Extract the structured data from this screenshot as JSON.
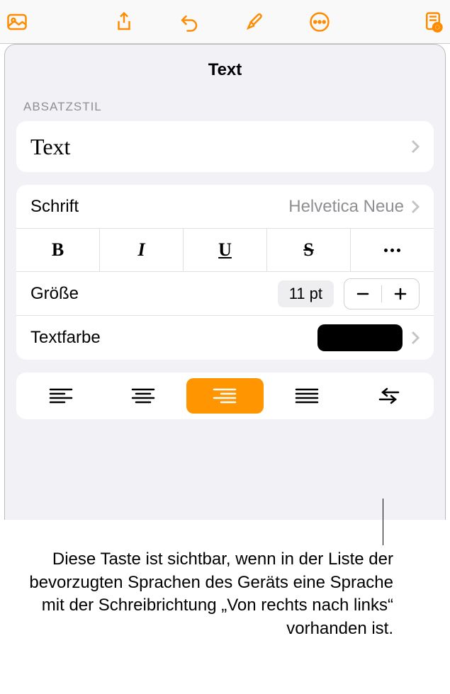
{
  "panel": {
    "title": "Text",
    "section_label": "ABSATZSTIL",
    "style_name": "Text",
    "font_label": "Schrift",
    "font_value": "Helvetica Neue",
    "size_label": "Größe",
    "size_value": "11 pt",
    "color_label": "Textfarbe",
    "color_value": "#000000"
  },
  "format_buttons": {
    "bold": "B",
    "italic": "I",
    "underline": "U",
    "strike": "S"
  },
  "callout": "Diese Taste ist sichtbar, wenn in der Liste der bevorzugten Sprachen des Geräts eine Sprache mit der Schreibrichtung „Von rechts nach links“ vorhanden ist."
}
